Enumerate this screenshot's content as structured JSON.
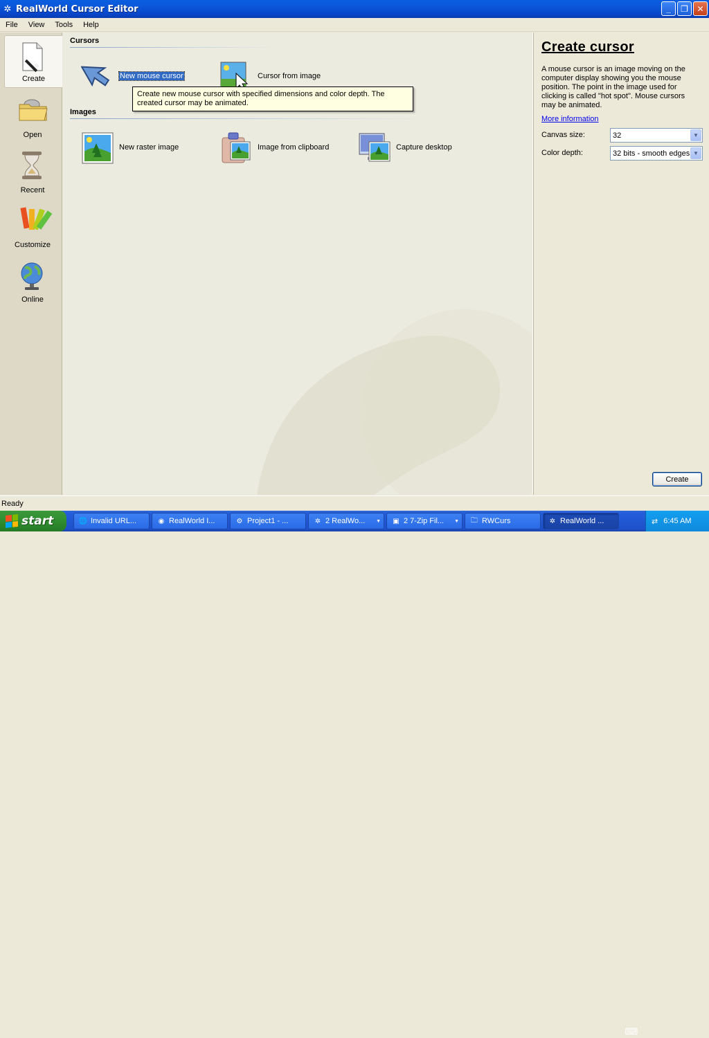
{
  "window": {
    "title": "RealWorld Cursor Editor",
    "min_label": "_",
    "max_label": "❐",
    "close_label": "✕"
  },
  "menu": {
    "items": [
      "File",
      "View",
      "Tools",
      "Help"
    ]
  },
  "nav": {
    "items": [
      {
        "label": "Create",
        "icon": "create-icon"
      },
      {
        "label": "Open",
        "icon": "open-folder-icon"
      },
      {
        "label": "Recent",
        "icon": "hourglass-icon"
      },
      {
        "label": "Customize",
        "icon": "pencils-icon"
      },
      {
        "label": "Online",
        "icon": "globe-icon"
      }
    ]
  },
  "main": {
    "cursors_header": "Cursors",
    "images_header": "Images",
    "cursor_tiles": [
      {
        "label": "New mouse cursor",
        "icon": "cursor-arrow-icon"
      },
      {
        "label": "Cursor from image",
        "icon": "cursor-from-image-icon"
      }
    ],
    "image_tiles": [
      {
        "label": "New raster image",
        "icon": "raster-image-icon"
      },
      {
        "label": "Image from clipboard",
        "icon": "clipboard-image-icon"
      },
      {
        "label": "Capture desktop",
        "icon": "capture-desktop-icon"
      }
    ],
    "tooltip": "Create new mouse cursor with specified dimensions and color depth. The created cursor may be animated."
  },
  "panel": {
    "title": "Create cursor",
    "description": "A mouse cursor is an image moving on the computer display showing you the mouse position. The point in the image used for clicking is called \"hot spot\". Mouse cursors may be animated.",
    "more_info": "More information",
    "canvas_label": "Canvas size:",
    "canvas_value": "32",
    "depth_label": "Color depth:",
    "depth_value": "32 bits - smooth edges",
    "create_label": "Create"
  },
  "status": {
    "text": "Ready"
  },
  "taskbar": {
    "start_label": "start",
    "tasks": [
      {
        "label": "Invalid URL...",
        "icon": "ie-icon"
      },
      {
        "label": "RealWorld I...",
        "icon": "chrome-icon"
      },
      {
        "label": "Project1 - ...",
        "icon": "project-icon"
      },
      {
        "label": "2 RealWo...",
        "icon": "realworld-icon"
      },
      {
        "label": "2 7-Zip Fil...",
        "icon": "7zip-icon"
      },
      {
        "label": "RWCurs",
        "icon": "folder-icon"
      },
      {
        "label": "RealWorld ...",
        "icon": "realworld-icon"
      }
    ],
    "clock": "6:45 AM"
  },
  "colors": {
    "selection": "#316ac5",
    "titlebar": "#0a5fe0",
    "taskbar": "#245edb",
    "start": "#2f8d2f"
  }
}
